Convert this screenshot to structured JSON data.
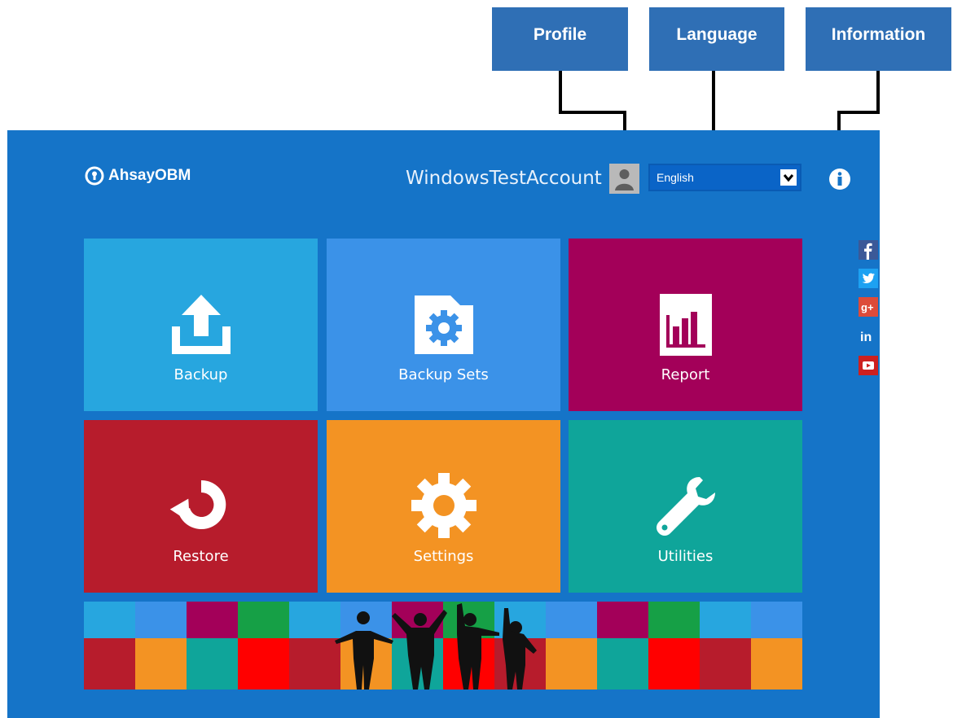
{
  "callouts": {
    "profile": "Profile",
    "language": "Language",
    "information": "Information"
  },
  "header": {
    "logo_text": "AhsayOBM",
    "account_name": "WindowsTestAccount",
    "language_value": "English"
  },
  "tiles": [
    {
      "label": "Backup",
      "icon": "upload-icon",
      "color": "#27a6df"
    },
    {
      "label": "Backup Sets",
      "icon": "folder-gear-icon",
      "color": "#3b92e8"
    },
    {
      "label": "Report",
      "icon": "bar-chart-icon",
      "color": "#a30059"
    },
    {
      "label": "Restore",
      "icon": "restore-arrow-icon",
      "color": "#b71c2c"
    },
    {
      "label": "Settings",
      "icon": "gear-icon",
      "color": "#f39323"
    },
    {
      "label": "Utilities",
      "icon": "wrench-icon",
      "color": "#0fa59a"
    }
  ],
  "social": [
    "facebook-icon",
    "twitter-icon",
    "google-plus-icon",
    "linkedin-icon",
    "youtube-icon"
  ],
  "colors": {
    "app_background": "#1574c8",
    "callout": "#2f6fb5"
  }
}
